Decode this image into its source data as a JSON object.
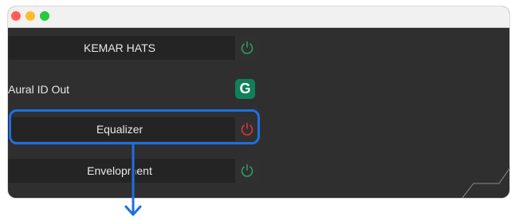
{
  "window": {
    "controls": [
      "close",
      "minimize",
      "zoom"
    ]
  },
  "rows": {
    "kemar": {
      "label": "KEMAR HATS",
      "power_state": "on",
      "power_color": "#2e9a62"
    },
    "aural": {
      "label": "Aural ID Out",
      "badge": "G",
      "badge_color": "#11805a"
    },
    "equalizer": {
      "label": "Equalizer",
      "power_state": "off",
      "power_color": "#e0323c"
    },
    "envelopment": {
      "label": "Envelopment",
      "power_state": "on",
      "power_color": "#2e9a62"
    }
  },
  "annotation": {
    "highlight_target": "Equalizer",
    "highlight_color": "#1f6fe0",
    "arrow_direction": "down"
  }
}
